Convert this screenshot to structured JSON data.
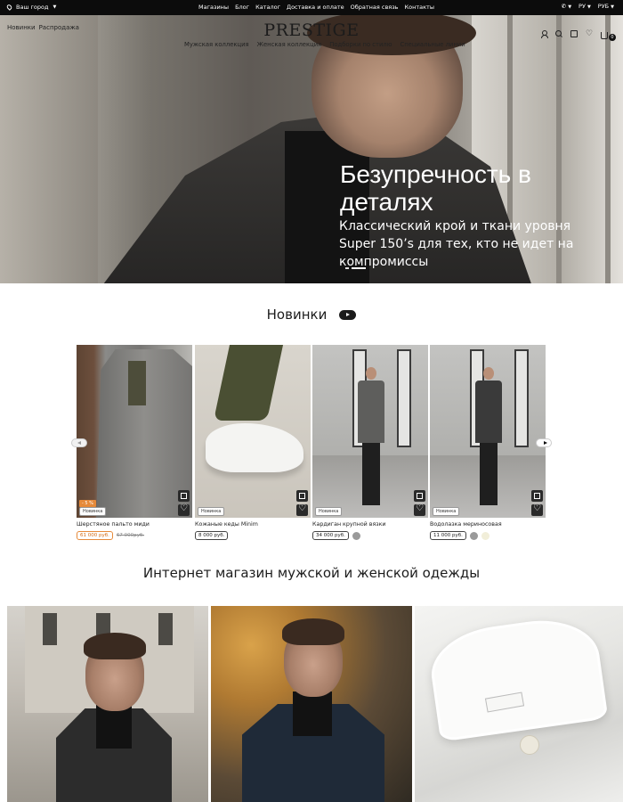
{
  "topbar": {
    "city_label": "Ваш город",
    "nav": [
      "Магазины",
      "Блог",
      "Каталог",
      "Доставка и оплате",
      "Обратная связь",
      "Контакты"
    ],
    "language": "РУ",
    "currency": "РУБ"
  },
  "header": {
    "left_links": [
      "Новинки",
      "Распродажа"
    ],
    "logo": "PRESTIGE",
    "menu": [
      "Мужская коллекция",
      "Женская коллекция",
      "Подборки по стилю",
      "Специальные линии"
    ],
    "cart_count": "0"
  },
  "hero": {
    "headline": "Безупречность в деталях",
    "subtitle": "Классический крой и ткани уровня Super 150’s для тех, кто не идет на компромиссы"
  },
  "new_arrivals": {
    "title": "Новинки",
    "products": [
      {
        "name": "Шерстяное пальто миди",
        "label": "Новинка",
        "discount": "- 5 %",
        "price": "61 000 руб.",
        "old_price": "67 000руб.",
        "colors": []
      },
      {
        "name": "Кожаные кеды Minim",
        "label": "Новинка",
        "discount": "",
        "price": "8 000 руб.",
        "old_price": "",
        "colors": []
      },
      {
        "name": "Кардиган крупной вязки",
        "label": "Новинка",
        "discount": "",
        "price": "34 000 руб.",
        "old_price": "",
        "colors": [
          "#9a9a9a"
        ]
      },
      {
        "name": "Водолазка мериносовая",
        "label": "Новинка",
        "discount": "",
        "price": "11 000 руб.",
        "old_price": "",
        "colors": [
          "#9a9a9a",
          "#f1eed9"
        ]
      }
    ]
  },
  "shop_title": "Интернет магазин мужской и женской одежды",
  "colors": {
    "accent": "#e68a3a",
    "dark": "#0c0c0c"
  }
}
